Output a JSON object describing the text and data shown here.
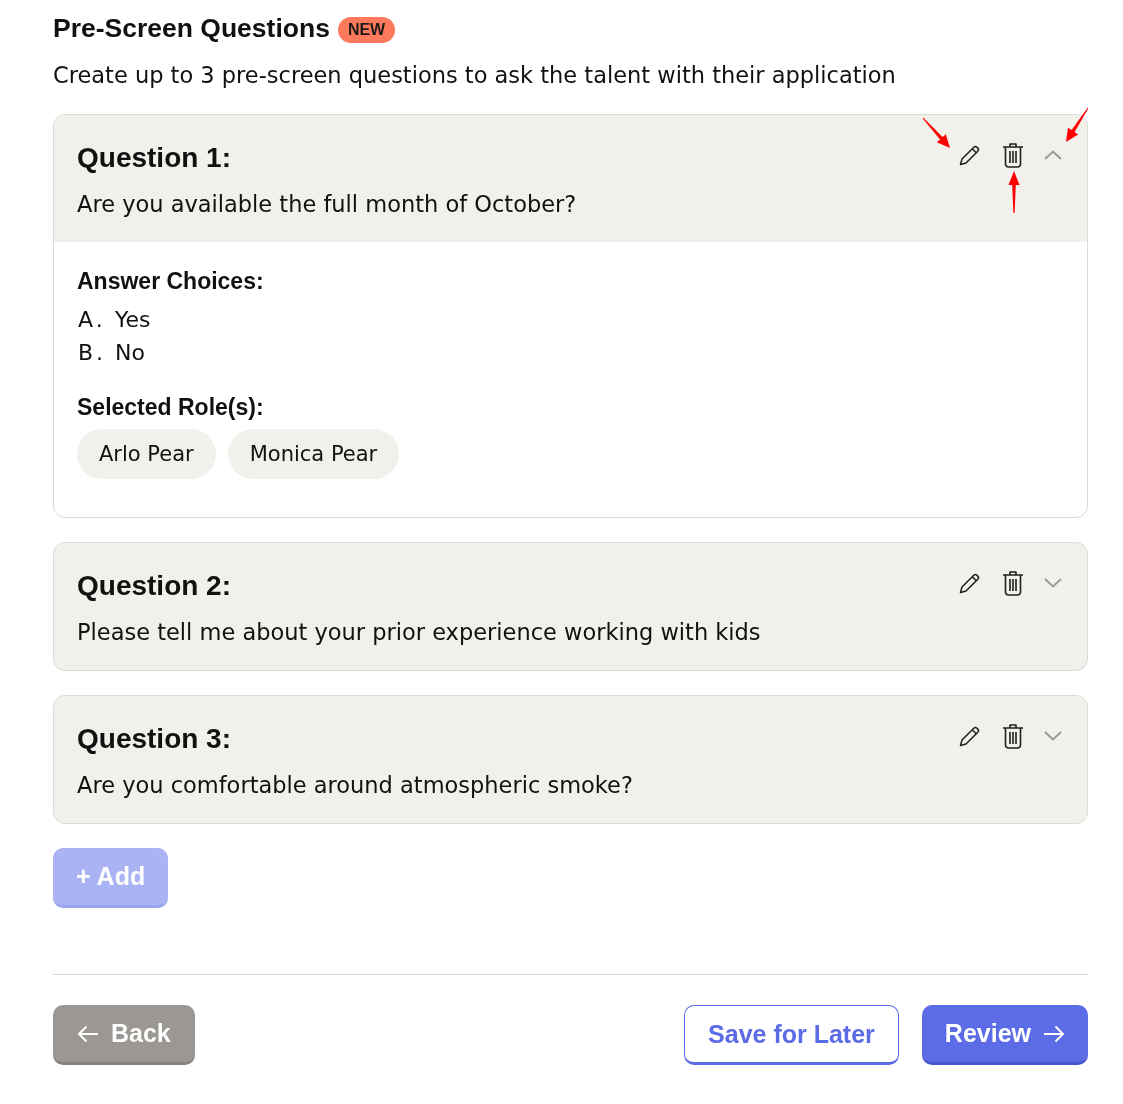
{
  "header": {
    "title": "Pre-Screen Questions",
    "badge": "NEW",
    "description": "Create up to 3 pre-screen questions to ask the talent with their application"
  },
  "questions": [
    {
      "title": "Question 1:",
      "text": "Are you available the full month of October?",
      "expanded": true,
      "annotated": true,
      "answer_heading": "Answer Choices:",
      "choices": [
        {
          "letter": "A.",
          "text": "Yes"
        },
        {
          "letter": "B.",
          "text": "No"
        }
      ],
      "roles_heading": "Selected Role(s):",
      "roles": [
        "Arlo Pear",
        "Monica Pear"
      ]
    },
    {
      "title": "Question 2:",
      "text": "Please tell me about your prior experience working with kids",
      "expanded": false,
      "annotated": false
    },
    {
      "title": "Question 3:",
      "text": "Are you comfortable around atmospheric smoke?",
      "expanded": false,
      "annotated": false
    }
  ],
  "add_button": {
    "label": "+ Add",
    "disabled": true
  },
  "footer": {
    "back": "Back",
    "save": "Save for Later",
    "review": "Review"
  }
}
